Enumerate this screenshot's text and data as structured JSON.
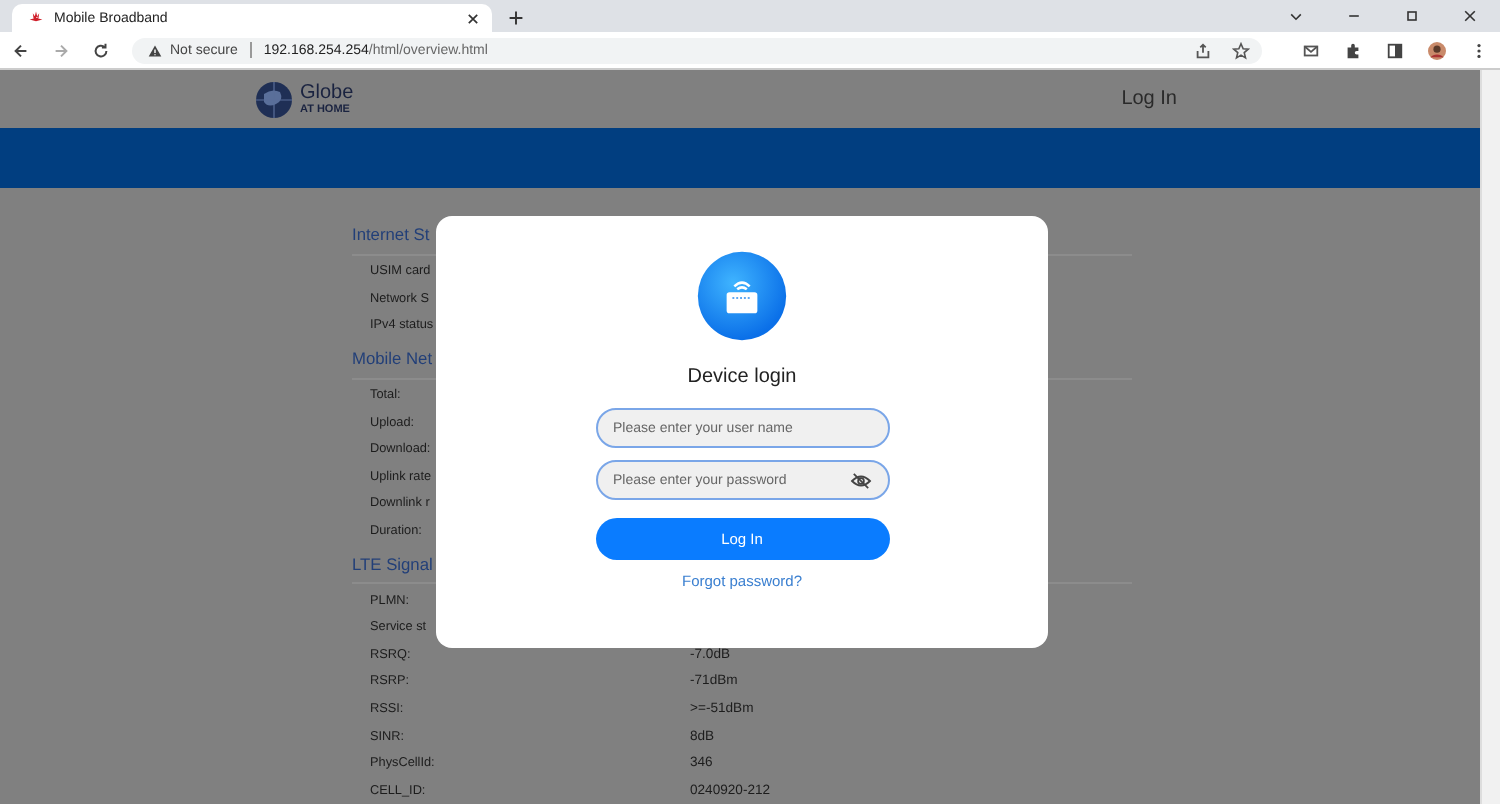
{
  "browser": {
    "tab": {
      "title": "Mobile Broadband",
      "selected": true
    },
    "security": "Not secure",
    "url_host": "192.168.254.254",
    "url_path": "/html/overview.html"
  },
  "header": {
    "logo_name": "Globe",
    "logo_sub": "AT HOME",
    "login_link": "Log In"
  },
  "sections": [
    {
      "title": "Internet St",
      "rows": [
        {
          "label": "USIM card"
        },
        {
          "label": "Network S"
        },
        {
          "label": "IPv4 status"
        }
      ]
    },
    {
      "title": "Mobile Net",
      "rows": [
        {
          "label": "Total:"
        },
        {
          "label": "Upload:"
        },
        {
          "label": "Download:"
        },
        {
          "label": "Uplink rate"
        },
        {
          "label": "Downlink r"
        },
        {
          "label": "Duration:"
        }
      ]
    },
    {
      "title": "LTE Signal",
      "rows": [
        {
          "label": "PLMN:"
        },
        {
          "label": "Service st"
        },
        {
          "label": "RSRQ:",
          "value": "-7.0dB"
        },
        {
          "label": "RSRP:",
          "value": "-71dBm"
        },
        {
          "label": "RSSI:",
          "value": ">=-51dBm"
        },
        {
          "label": "SINR:",
          "value": "8dB"
        },
        {
          "label": "PhysCellId:",
          "value": "346"
        },
        {
          "label": "CELL_ID:",
          "value": "0240920-212"
        }
      ]
    }
  ],
  "dialog": {
    "title": "Device login",
    "username_placeholder": "Please enter your user name",
    "password_placeholder": "Please enter your password",
    "button": "Log In",
    "forgot": "Forgot password?"
  }
}
